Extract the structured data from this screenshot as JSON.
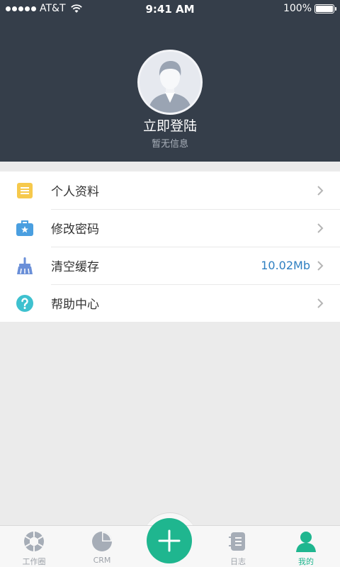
{
  "status_bar": {
    "carrier": "AT&T",
    "time": "9:41 AM",
    "battery": "100%"
  },
  "profile": {
    "title": "立即登陆",
    "subtitle": "暂无信息"
  },
  "menu": {
    "items": [
      {
        "label": "个人资料",
        "icon": "document-icon",
        "icon_color": "#f6c94c"
      },
      {
        "label": "修改密码",
        "icon": "lock-box-icon",
        "icon_color": "#4a9fe0"
      },
      {
        "label": "清空缓存",
        "icon": "broom-icon",
        "icon_color": "#6a8fd8",
        "value": "10.02Mb"
      },
      {
        "label": "帮助中心",
        "icon": "help-icon",
        "icon_color": "#3ec1cf"
      }
    ]
  },
  "tabbar": {
    "tabs": [
      {
        "label": "工作圈",
        "icon": "aperture-icon"
      },
      {
        "label": "CRM",
        "icon": "pie-chart-icon"
      },
      {
        "label": "日志",
        "icon": "log-list-icon"
      },
      {
        "label": "我的",
        "icon": "person-icon",
        "active": true
      }
    ],
    "add_icon": "plus-icon"
  },
  "colors": {
    "header_bg": "#353e4a",
    "accent_green": "#1fb68f",
    "value_blue": "#2e7fc1"
  }
}
